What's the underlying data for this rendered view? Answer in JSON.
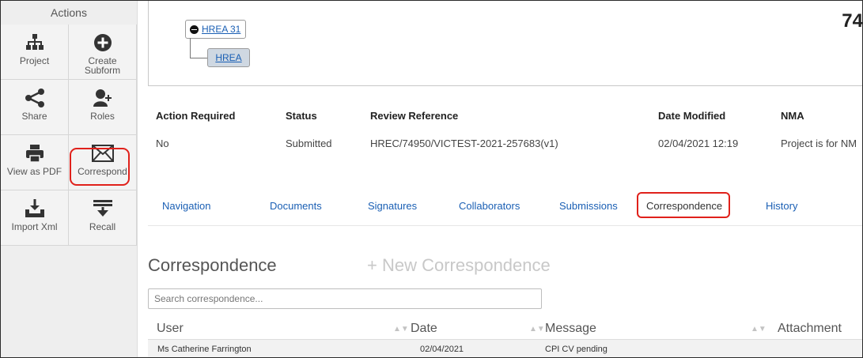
{
  "sidebar": {
    "title": "Actions",
    "tiles": [
      {
        "label": "Project",
        "icon": "project-hierarchy-icon"
      },
      {
        "label": "Create\nSubform",
        "icon": "plus-circle-icon"
      },
      {
        "label": "Share",
        "icon": "share-icon"
      },
      {
        "label": "Roles",
        "icon": "user-plus-icon"
      },
      {
        "label": "View as PDF",
        "icon": "printer-icon"
      },
      {
        "label": "Correspond",
        "icon": "envelope-icon"
      },
      {
        "label": "Import Xml",
        "icon": "import-tray-icon"
      },
      {
        "label": "Recall",
        "icon": "recall-icon"
      }
    ],
    "create_line1": "Create",
    "create_line2": "Subform"
  },
  "tree": {
    "parent": "HREA 31",
    "child": "HREA",
    "project_number": "74"
  },
  "summary": {
    "headers": [
      "Action Required",
      "Status",
      "Review Reference",
      "Date Modified",
      "NMA"
    ],
    "row": [
      "No",
      "Submitted",
      "HREC/74950/VICTEST-2021-257683(v1)",
      "02/04/2021 12:19",
      "Project is for NM"
    ]
  },
  "tabs": [
    "Navigation",
    "Documents",
    "Signatures",
    "Collaborators",
    "Submissions",
    "Correspondence",
    "History"
  ],
  "active_tab": "Correspondence",
  "correspondence": {
    "title": "Correspondence",
    "new_label": "+ New Correspondence",
    "search_placeholder": "Search correspondence...",
    "columns": [
      "User",
      "Date",
      "Message",
      "Attachment"
    ],
    "rows": [
      {
        "user": "Ms Catherine Farrington",
        "date": "02/04/2021",
        "message": "CPI CV pending",
        "attachment": ""
      }
    ]
  },
  "colors": {
    "link": "#1a5fb4",
    "highlight": "#e0211b",
    "sidebar_bg": "#eeeeee"
  }
}
